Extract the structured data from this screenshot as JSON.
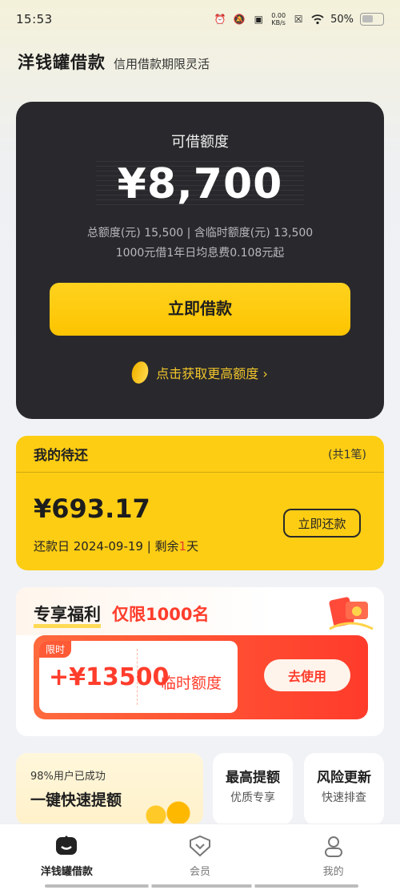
{
  "status_bar": {
    "time": "15:53",
    "net_speed_value": "0.00",
    "net_speed_unit": "KB/s",
    "battery": "50%"
  },
  "header": {
    "title": "洋钱罐借款",
    "slogan": "信用借款期限灵活"
  },
  "credit": {
    "label": "可借额度",
    "amount": "¥8,700",
    "detail": "总额度(元) 15,500 | 含临时额度(元) 13,500",
    "rate": "1000元借1年日均息费0.108元起",
    "borrow_button": "立即借款",
    "more_limit": "点击获取更高额度 ›"
  },
  "repay": {
    "title": "我的待还",
    "count": "(共1笔)",
    "amount": "¥693.17",
    "date_prefix": "还款日 2024-09-19 | 剩余",
    "days": "1",
    "date_suffix": "天",
    "button": "立即还款"
  },
  "benefit": {
    "title": "专享福利",
    "limited": "仅限1000名",
    "coupon_tag": "限时",
    "coupon_value": "+¥13500",
    "coupon_label": "临时额度",
    "use_button": "去使用"
  },
  "promos": {
    "big_sub": "98%用户已成功",
    "big_main": "一键快速提额",
    "items": [
      {
        "title": "最高提额",
        "subtitle": "优质专享"
      },
      {
        "title": "风险更新",
        "subtitle": "快速排查"
      }
    ]
  },
  "tabs": [
    {
      "label": "洋钱罐借款",
      "icon": "home-icon",
      "active": true
    },
    {
      "label": "会员",
      "icon": "member-icon",
      "active": false
    },
    {
      "label": "我的",
      "icon": "profile-icon",
      "active": false
    }
  ],
  "colors": {
    "accent_yellow": "#fdcd14",
    "card_dark": "#29292d",
    "accent_red": "#ff3d2c"
  }
}
